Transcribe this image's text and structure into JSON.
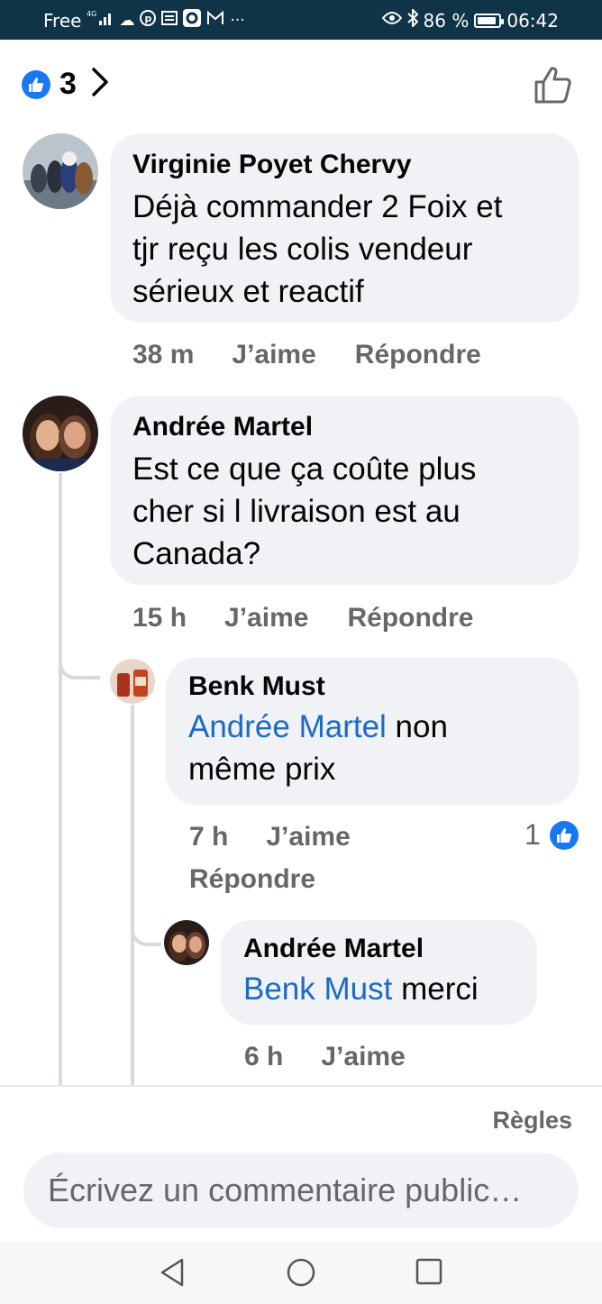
{
  "status_bar": {
    "carrier": "Free",
    "battery": "86 %",
    "time": "06:42"
  },
  "reactions": {
    "count": "3"
  },
  "comments": [
    {
      "author": "Virginie Poyet Chervy",
      "lines": [
        "Déjà commander 2 Foix et",
        "tjr reçu les colis vendeur",
        "sérieux et reactif"
      ],
      "time": "38 m",
      "like_label": "J’aime",
      "reply_label": "Répondre"
    },
    {
      "author": "Andrée Martel",
      "lines": [
        "Est ce que ça coûte plus",
        "cher si l livraison est au",
        "Canada?"
      ],
      "time": "15 h",
      "like_label": "J’aime",
      "reply_label": "Répondre"
    },
    {
      "author": "Benk Must",
      "mention": "Andrée Martel",
      "line1_rest": " non",
      "line2": "même prix",
      "time": "7 h",
      "like_label": "J’aime",
      "reply_label": "Répondre",
      "reaction_count": "1"
    },
    {
      "author": "Andrée Martel",
      "mention": "Benk Must",
      "line1_rest": " merci",
      "time": "6 h",
      "like_label": "J’aime"
    }
  ],
  "footer": {
    "rules_label": "Règles",
    "composer_placeholder": "Écrivez un commentaire public…"
  },
  "colors": {
    "status_bar": "#0f3347",
    "bubble": "#f0f2f5",
    "mention": "#1b6ac9",
    "like_blue": "#1877f2",
    "secondary_text": "#65676b"
  }
}
